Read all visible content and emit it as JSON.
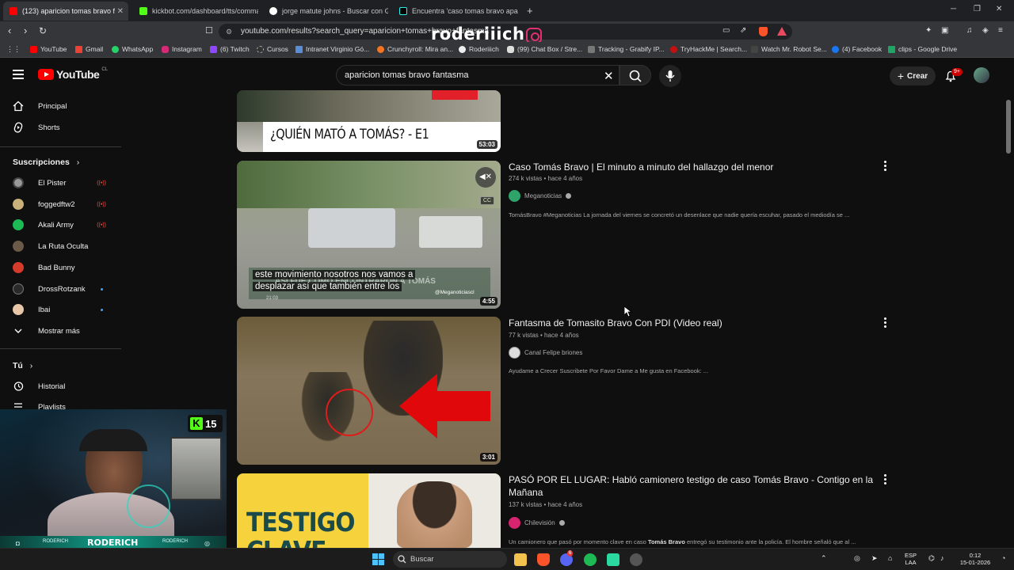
{
  "browser": {
    "tabs": [
      {
        "label": "(123) aparicion tomas bravo f",
        "active": true
      },
      {
        "label": "kickbot.com/dashboard/tts/comman"
      },
      {
        "label": "jorge matute johns - Buscar con Goo"
      },
      {
        "label": "Encuentra 'caso tomas bravo aparicio"
      }
    ],
    "new_tab": "+",
    "url": "youtube.com/results?search_query=aparicion+tomas+bravo+fantasma",
    "overlay_brand": "roderiiich",
    "bookmarks": [
      "YouTube",
      "Gmail",
      "WhatsApp",
      "Instagram",
      "(6) Twitch",
      "Cursos",
      "Intranet Virginio Gó...",
      "Crunchyroll: Mira an...",
      "Roderiiich",
      "(99) Chat Box / Stre...",
      "Tracking - Grabify IP...",
      "TryHackMe | Search...",
      "Watch Mr. Robot Se...",
      "(4) Facebook",
      "clips - Google Drive"
    ],
    "colors": {
      "tabstrip": "#1f2024",
      "toolbar": "#35363a"
    }
  },
  "youtube": {
    "logo_text": "YouTube",
    "country": "CL",
    "search_query": "aparicion tomas bravo fantasma",
    "create_label": "Crear",
    "notifications": "9+",
    "accent": "#ff0000"
  },
  "sidebar": {
    "main": [
      {
        "label": "Principal",
        "icon": "home-icon"
      },
      {
        "label": "Shorts",
        "icon": "shorts-icon"
      }
    ],
    "subscriptions_header": "Suscripciones",
    "subscriptions": [
      {
        "label": "El Pister",
        "status": "live"
      },
      {
        "label": "foggedftw2",
        "status": "live"
      },
      {
        "label": "Akali Army",
        "status": "live"
      },
      {
        "label": "La Ruta Oculta",
        "status": ""
      },
      {
        "label": "Bad Bunny",
        "status": ""
      },
      {
        "label": "DrossRotzank",
        "status": "new"
      },
      {
        "label": "Ibai",
        "status": "new"
      }
    ],
    "show_more": "Mostrar más",
    "you_header": "Tú",
    "you_items": [
      {
        "label": "Historial",
        "icon": "history-icon"
      },
      {
        "label": "Playlists",
        "icon": "playlists-icon"
      }
    ]
  },
  "results": [
    {
      "thumb_caption": "¿QUIÉN MATÓ A TOMÁS? - E1",
      "duration": "53:03"
    },
    {
      "title": "Caso Tomás Bravo | El minuto a minuto del hallazgo del menor",
      "views": "274 k vistas",
      "age": "hace 4 años",
      "channel": "Meganoticias",
      "verified": true,
      "description": "TomásBravo #Meganoticias La jornada del viernes se concretó un desenlace que nadie quería escuhar, pasado el mediodía se ...",
      "duration": "4:55",
      "cc": "CC",
      "subtitle_line1": "este movimiento nosotros nos vamos a",
      "subtitle_line2": "desplazar así que también entre los",
      "burned_caption": "ASÍ FUE COMO ENCONTRARON A TOMÁS",
      "watermark": "@Meganoticiascl",
      "timestamp": "21:03"
    },
    {
      "title": "Fantasma de Tomasito Bravo Con PDI (Video real)",
      "views": "77 k vistas",
      "age": "hace 4 años",
      "channel": "Canal Felipe briones",
      "verified": false,
      "description": "Ayudame a Crecer Suscribete Por Favor Dame a Me gusta en Facebook: ...",
      "duration": "3:01"
    },
    {
      "title": "PASÓ POR EL LUGAR: Habló camionero testigo de caso Tomás Bravo - Contigo en la Mañana",
      "views": "137 k vistas",
      "age": "hace 4 años",
      "channel": "Chilevisión",
      "verified": true,
      "description_pre": "Un camionero que pasó por momento clave en caso ",
      "description_bold": "Tomás Bravo",
      "description_post": " entregó su testimonio ante la policía. El hombre señaló que al ...",
      "thumb_text1": "TESTIGO",
      "thumb_text2": "CLAVE"
    }
  ],
  "webcam": {
    "name": "RODERICH",
    "side_tag_left": "RODERICH",
    "side_tag_right": "RODERICH",
    "kick_count": "15"
  },
  "taskbar": {
    "search_placeholder": "Buscar",
    "lang": "ESP",
    "region": "LAA",
    "time": "0:12",
    "date": "15-01-2026",
    "discord_badge": "6"
  }
}
